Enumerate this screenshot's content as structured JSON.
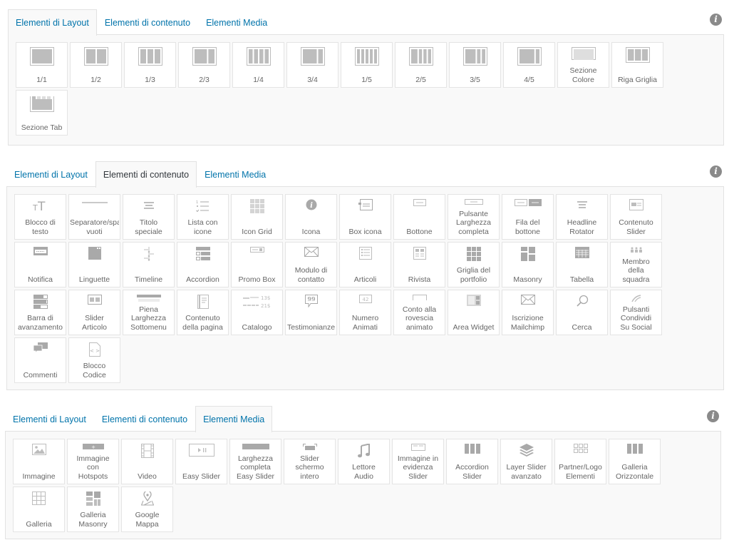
{
  "sections": [
    {
      "tabs": [
        {
          "label": "Elementi di Layout",
          "active": true
        },
        {
          "label": "Elementi di contenuto",
          "active": false
        },
        {
          "label": "Elementi Media",
          "active": false
        }
      ],
      "info_icon": "info-icon",
      "items": [
        {
          "label": "1/1",
          "icon": "col-1-1"
        },
        {
          "label": "1/2",
          "icon": "col-1-2"
        },
        {
          "label": "1/3",
          "icon": "col-1-3"
        },
        {
          "label": "2/3",
          "icon": "col-2-3"
        },
        {
          "label": "1/4",
          "icon": "col-1-4"
        },
        {
          "label": "3/4",
          "icon": "col-3-4"
        },
        {
          "label": "1/5",
          "icon": "col-1-5"
        },
        {
          "label": "2/5",
          "icon": "col-2-5"
        },
        {
          "label": "3/5",
          "icon": "col-3-5"
        },
        {
          "label": "4/5",
          "icon": "col-4-5"
        },
        {
          "label": "Sezione\nColore",
          "icon": "color-section"
        },
        {
          "label": "Riga Griglia",
          "icon": "grid-row"
        },
        {
          "label": "Sezione Tab",
          "icon": "tab-section"
        }
      ]
    },
    {
      "tabs": [
        {
          "label": "Elementi di Layout",
          "active": false
        },
        {
          "label": "Elementi di contenuto",
          "active": true
        },
        {
          "label": "Elementi Media",
          "active": false
        }
      ],
      "info_icon": "info-icon",
      "items": [
        {
          "label": "Blocco di\ntesto",
          "icon": "text-block"
        },
        {
          "label": "Separatore/spazi\nvuoti",
          "icon": "separator"
        },
        {
          "label": "Titolo\nspeciale",
          "icon": "special-heading"
        },
        {
          "label": "Lista con\nicone",
          "icon": "icon-list"
        },
        {
          "label": "Icon Grid",
          "icon": "icon-grid"
        },
        {
          "label": "Icona",
          "icon": "info-circle"
        },
        {
          "label": "Box icona",
          "icon": "icon-box"
        },
        {
          "label": "Bottone",
          "icon": "button"
        },
        {
          "label": "Pulsante\nLarghezza\ncompleta",
          "icon": "fullwidth-button"
        },
        {
          "label": "Fila del\nbottone",
          "icon": "button-row"
        },
        {
          "label": "Headline\nRotator",
          "icon": "headline-rotator"
        },
        {
          "label": "Contenuto\nSlider",
          "icon": "content-slider"
        },
        {
          "label": "Notifica",
          "icon": "notification"
        },
        {
          "label": "Linguette",
          "icon": "tabs"
        },
        {
          "label": "Timeline",
          "icon": "timeline"
        },
        {
          "label": "Accordion",
          "icon": "accordion"
        },
        {
          "label": "Promo Box",
          "icon": "promo-box"
        },
        {
          "label": "Modulo di\ncontatto",
          "icon": "envelope"
        },
        {
          "label": "Articoli",
          "icon": "posts"
        },
        {
          "label": "Rivista",
          "icon": "magazine"
        },
        {
          "label": "Griglia del\nportfolio",
          "icon": "portfolio-grid"
        },
        {
          "label": "Masonry",
          "icon": "masonry"
        },
        {
          "label": "Tabella",
          "icon": "table"
        },
        {
          "label": "Membro\ndella\nsquadra",
          "icon": "team-member"
        },
        {
          "label": "Barra di\navanzamento",
          "icon": "progress-bars"
        },
        {
          "label": "Slider\nArticolo",
          "icon": "post-slider"
        },
        {
          "label": "Piena\nLarghezza\nSottomenu",
          "icon": "fullwidth-submenu"
        },
        {
          "label": "Contenuto\ndella pagina",
          "icon": "page-content"
        },
        {
          "label": "Catalogo",
          "icon": "catalogue",
          "prices": [
            "13$",
            "21$"
          ]
        },
        {
          "label": "Testimonianze",
          "icon": "testimonial"
        },
        {
          "label": "Numero\nAnimati",
          "icon": "animated-number",
          "number": "42"
        },
        {
          "label": "Conto alla\nrovescia\nanimato",
          "icon": "countdown"
        },
        {
          "label": "Area Widget",
          "icon": "widget-area"
        },
        {
          "label": "Iscrizione\nMailchimp",
          "icon": "envelope"
        },
        {
          "label": "Cerca",
          "icon": "search"
        },
        {
          "label": "Pulsanti\nCondividi\nSu Social",
          "icon": "social-share"
        },
        {
          "label": "Commenti",
          "icon": "comments"
        },
        {
          "label": "Blocco\nCodice",
          "icon": "code-block"
        }
      ]
    },
    {
      "tabs": [
        {
          "label": "Elementi di Layout",
          "active": false
        },
        {
          "label": "Elementi di contenuto",
          "active": false
        },
        {
          "label": "Elementi Media",
          "active": true
        }
      ],
      "info_icon": "info-icon",
      "items": [
        {
          "label": "Immagine",
          "icon": "image"
        },
        {
          "label": "Immagine\ncon\nHotspots",
          "icon": "image-hotspots"
        },
        {
          "label": "Video",
          "icon": "film"
        },
        {
          "label": "Easy Slider",
          "icon": "easy-slider"
        },
        {
          "label": "Larghezza\ncompleta\nEasy Slider",
          "icon": "fullwidth-slider"
        },
        {
          "label": "Slider\nschermo\nintero",
          "icon": "fullscreen-slider"
        },
        {
          "label": "Lettore\nAudio",
          "icon": "music-note"
        },
        {
          "label": "Immagine in\nevidenza\nSlider",
          "icon": "featured-image-slider"
        },
        {
          "label": "Accordion\nSlider",
          "icon": "accordion-slider"
        },
        {
          "label": "Layer Slider\navanzato",
          "icon": "layers"
        },
        {
          "label": "Partner/Logo\nElementi",
          "icon": "logo-grid"
        },
        {
          "label": "Galleria\nOrizzontale",
          "icon": "horizontal-gallery"
        },
        {
          "label": "Galleria",
          "icon": "gallery-grid"
        },
        {
          "label": "Galleria\nMasonry",
          "icon": "masonry-gallery"
        },
        {
          "label": "Google\nMappa",
          "icon": "map-pin"
        }
      ]
    }
  ],
  "colors": {
    "tab_link": "#0073aa",
    "tab_active_dark": "#32373c",
    "panel_bg": "#f9f9f9",
    "border": "#e2e2e2",
    "icon_gray": "#bdbdbd",
    "label_gray": "#666666",
    "info_icon": "#8a8a8a"
  }
}
